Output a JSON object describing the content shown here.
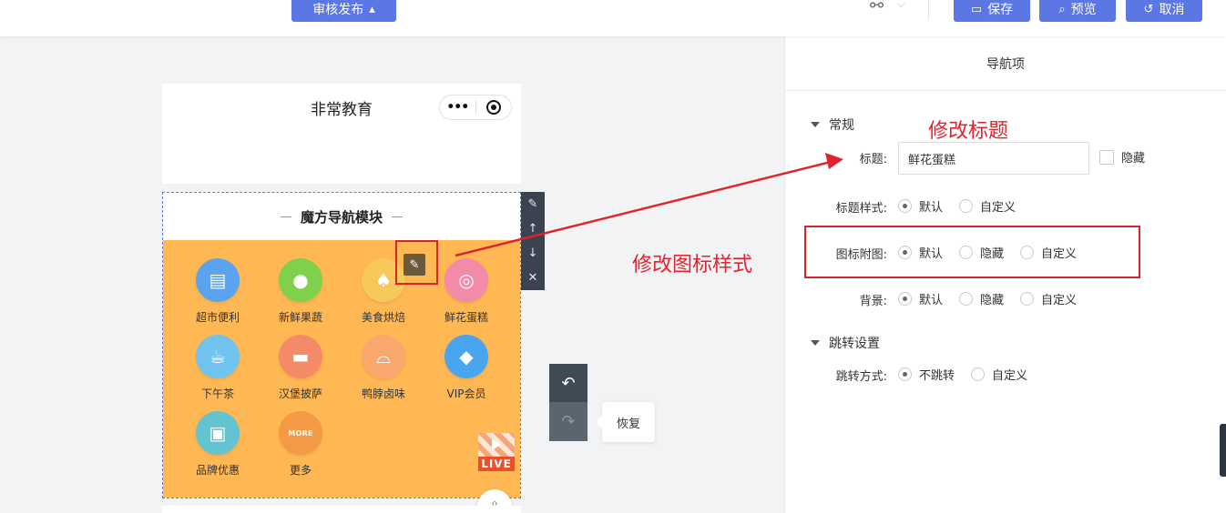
{
  "toolbar": {
    "review_label": "审核发布",
    "save_label": "保存",
    "preview_label": "预览",
    "cancel_label": "取消"
  },
  "panel": {
    "title": "导航项",
    "sections": {
      "general": "常规",
      "jump": "跳转设置"
    },
    "title_row": {
      "label": "标题:",
      "value": "鲜花蛋糕",
      "hide_label": "隐藏"
    },
    "title_style": {
      "label": "标题样式:",
      "options": [
        "默认",
        "自定义"
      ]
    },
    "icon_image": {
      "label": "图标附图:",
      "options": [
        "默认",
        "隐藏",
        "自定义"
      ]
    },
    "background": {
      "label": "背景:",
      "options": [
        "默认",
        "隐藏",
        "自定义"
      ]
    },
    "jump_mode": {
      "label": "跳转方式:",
      "options": [
        "不跳转",
        "自定义"
      ]
    }
  },
  "annotations": {
    "edit_title": "修改标题",
    "edit_icon_style": "修改图标样式",
    "color": "#e02530"
  },
  "phone": {
    "title": "非常教育",
    "capsule_dots": "•••",
    "module_title": "魔方导航模块",
    "more_text": "MORE",
    "live_text": "LIVE",
    "nav_items": [
      {
        "label": "超市便利",
        "icon": "store-icon",
        "color": "#5aa4ef"
      },
      {
        "label": "新鲜果蔬",
        "icon": "apple-icon",
        "color": "#7fd04a"
      },
      {
        "label": "美食烘焙",
        "icon": "cake-icon",
        "color": "#f7c95a"
      },
      {
        "label": "鲜花蛋糕",
        "icon": "donut-icon",
        "color": "#f38aa8"
      },
      {
        "label": "下午茶",
        "icon": "cup-icon",
        "color": "#70c3ee"
      },
      {
        "label": "汉堡披萨",
        "icon": "burger-icon",
        "color": "#f58a68"
      },
      {
        "label": "鸭脖卤味",
        "icon": "cloche-icon",
        "color": "#fba86f"
      },
      {
        "label": "VIP会员",
        "icon": "diamond-icon",
        "color": "#4aa5ef"
      },
      {
        "label": "品牌优惠",
        "icon": "gift-icon",
        "color": "#63c3d1"
      },
      {
        "label": "更多",
        "icon": "more-icon",
        "color": "#f59a44"
      }
    ]
  },
  "history": {
    "redo_tooltip": "恢复"
  },
  "colors": {
    "accent": "#5b77e4",
    "module_bg": "#ffb854"
  }
}
